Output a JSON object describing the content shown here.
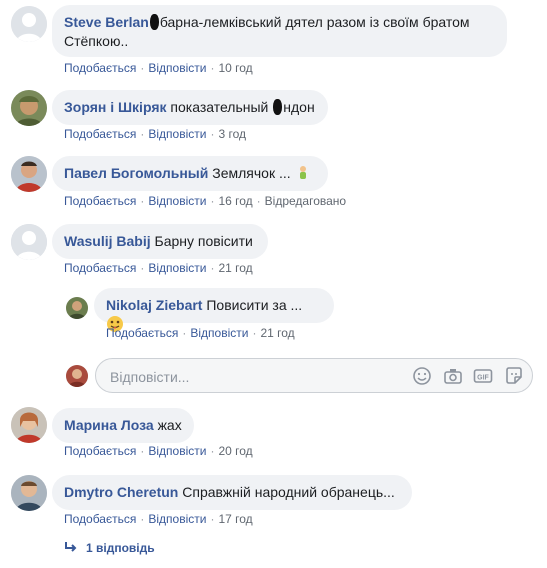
{
  "comments": [
    {
      "author": "Steve Berlan",
      "text_line1": "барна-лемківський дятел разом із своїм братом",
      "text_line2": "Стёпкою..",
      "like": "Подобається",
      "reply": "Відповісти",
      "time": "10 год"
    },
    {
      "author": "Зорян і Шкіряк",
      "text_before": "показательный ",
      "text_after": "ндон",
      "like": "Подобається",
      "reply": "Відповісти",
      "time": "3 год"
    },
    {
      "author": "Павел Богомольный",
      "text": "Землячок ...",
      "emoji": "person-emoji",
      "like": "Подобається",
      "reply": "Відповісти",
      "time": "16 год",
      "edited": "Відредаговано"
    },
    {
      "author": "Wasulij Babij",
      "text": "Барну повісити",
      "like": "Подобається",
      "reply": "Відповісти",
      "time": "21 год"
    },
    {
      "author": "Марина Лоза",
      "text": "жах",
      "like": "Подобається",
      "reply": "Відповісти",
      "time": "20 год"
    },
    {
      "author": "Dmytro Cheretun",
      "text": "Справжній народний обранець...",
      "like": "Подобається",
      "reply": "Відповісти",
      "time": "17 год"
    }
  ],
  "reply": {
    "author": "Nikolaj Ziebart",
    "text": "Повисити за ...",
    "emoji": "tongue-out-emoji",
    "like": "Подобається",
    "reply": "Відповісти",
    "time": "21 год"
  },
  "reply_box": {
    "placeholder": "Відповісти..."
  },
  "replies_link": {
    "label": "1 відповідь"
  },
  "icons": [
    "smile-icon",
    "camera-icon",
    "gif-icon",
    "sticker-icon",
    "reply-arrow-icon"
  ],
  "colors": {
    "link": "#385898",
    "bubble": "#f0f2f5",
    "meta": "#606770"
  }
}
